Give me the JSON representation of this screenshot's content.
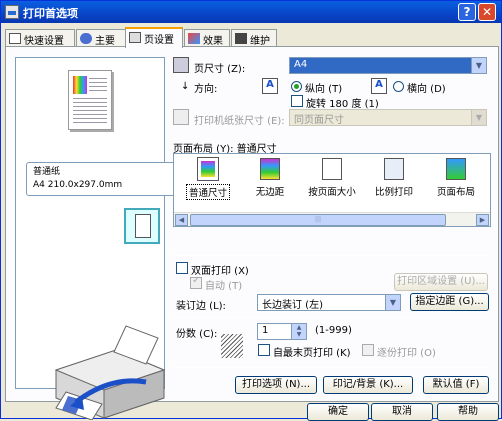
{
  "window": {
    "title": "打印首选项"
  },
  "tabs": [
    {
      "label": "快速设置",
      "icon": "quick-setup-icon"
    },
    {
      "label": "主要",
      "icon": "main-icon"
    },
    {
      "label": "页设置",
      "icon": "page-setup-icon",
      "active": true
    },
    {
      "label": "效果",
      "icon": "effects-icon"
    },
    {
      "label": "维护",
      "icon": "maintenance-icon"
    }
  ],
  "preview": {
    "paper_name": "普通纸",
    "paper_dims": "A4 210.0x297.0mm"
  },
  "page_size": {
    "label": "页尺寸 (Z):",
    "value": "A4"
  },
  "orientation": {
    "label": "方向:",
    "portrait": "纵向 (T)",
    "landscape": "横向 (D)",
    "selected": "portrait",
    "rotate_label": "旋转 180 度 (1)"
  },
  "printer_paper_size": {
    "label": "打印机纸张尺寸 (E):",
    "value": "同页面尺寸"
  },
  "page_layout": {
    "label": "页面布局 (Y):",
    "current": "普通尺寸",
    "items": [
      {
        "label": "普通尺寸",
        "selected": true
      },
      {
        "label": "无边距"
      },
      {
        "label": "按页面大小"
      },
      {
        "label": "比例打印"
      },
      {
        "label": "页面布局"
      }
    ]
  },
  "duplex": {
    "label": "双面打印 (X)",
    "auto_label": "自动 (T)",
    "area_settings_button": "打印区域设置 (U)..."
  },
  "binding": {
    "label": "装订边 (L):",
    "value": "长边装订 (左)",
    "margin_button": "指定边距 (G)..."
  },
  "copies": {
    "label": "份数 (C):",
    "value": "1",
    "range": "(1-999)",
    "last_page_first": "自最末页打印 (K)",
    "collate": "逐份打印 (O)"
  },
  "actions": {
    "print_options": "打印选项 (N)...",
    "stamp_background": "印记/背景 (K)...",
    "defaults": "默认值 (F)"
  },
  "dialog_buttons": {
    "ok": "确定",
    "cancel": "取消",
    "help": "帮助"
  }
}
